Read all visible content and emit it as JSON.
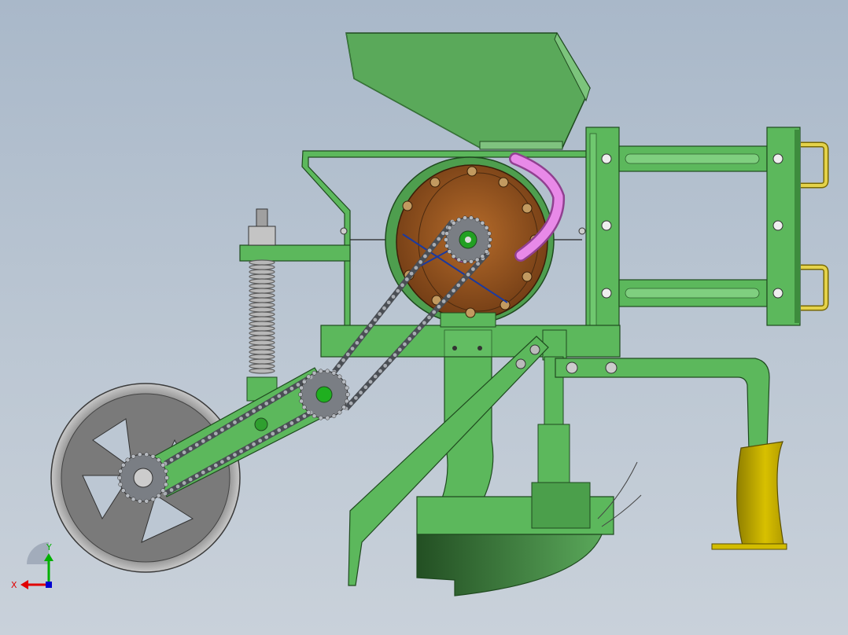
{
  "axes": {
    "x_label": "X",
    "y_label": "Y"
  },
  "colors": {
    "frame_green": "#5cb85c",
    "frame_dark": "#2f6f2f",
    "hopper_green": "#5aa95a",
    "meter_bronze": "#8a4e1e",
    "seed_tube": "#e080e0",
    "wheel_gray": "#8c8c8c",
    "chain_gray": "#6d7177",
    "spring_gray": "#a0a0a0",
    "shoe_yellow": "#c8b000",
    "axis_red": "#e00000",
    "axis_green": "#00b000",
    "axis_blue": "#0000d0"
  }
}
